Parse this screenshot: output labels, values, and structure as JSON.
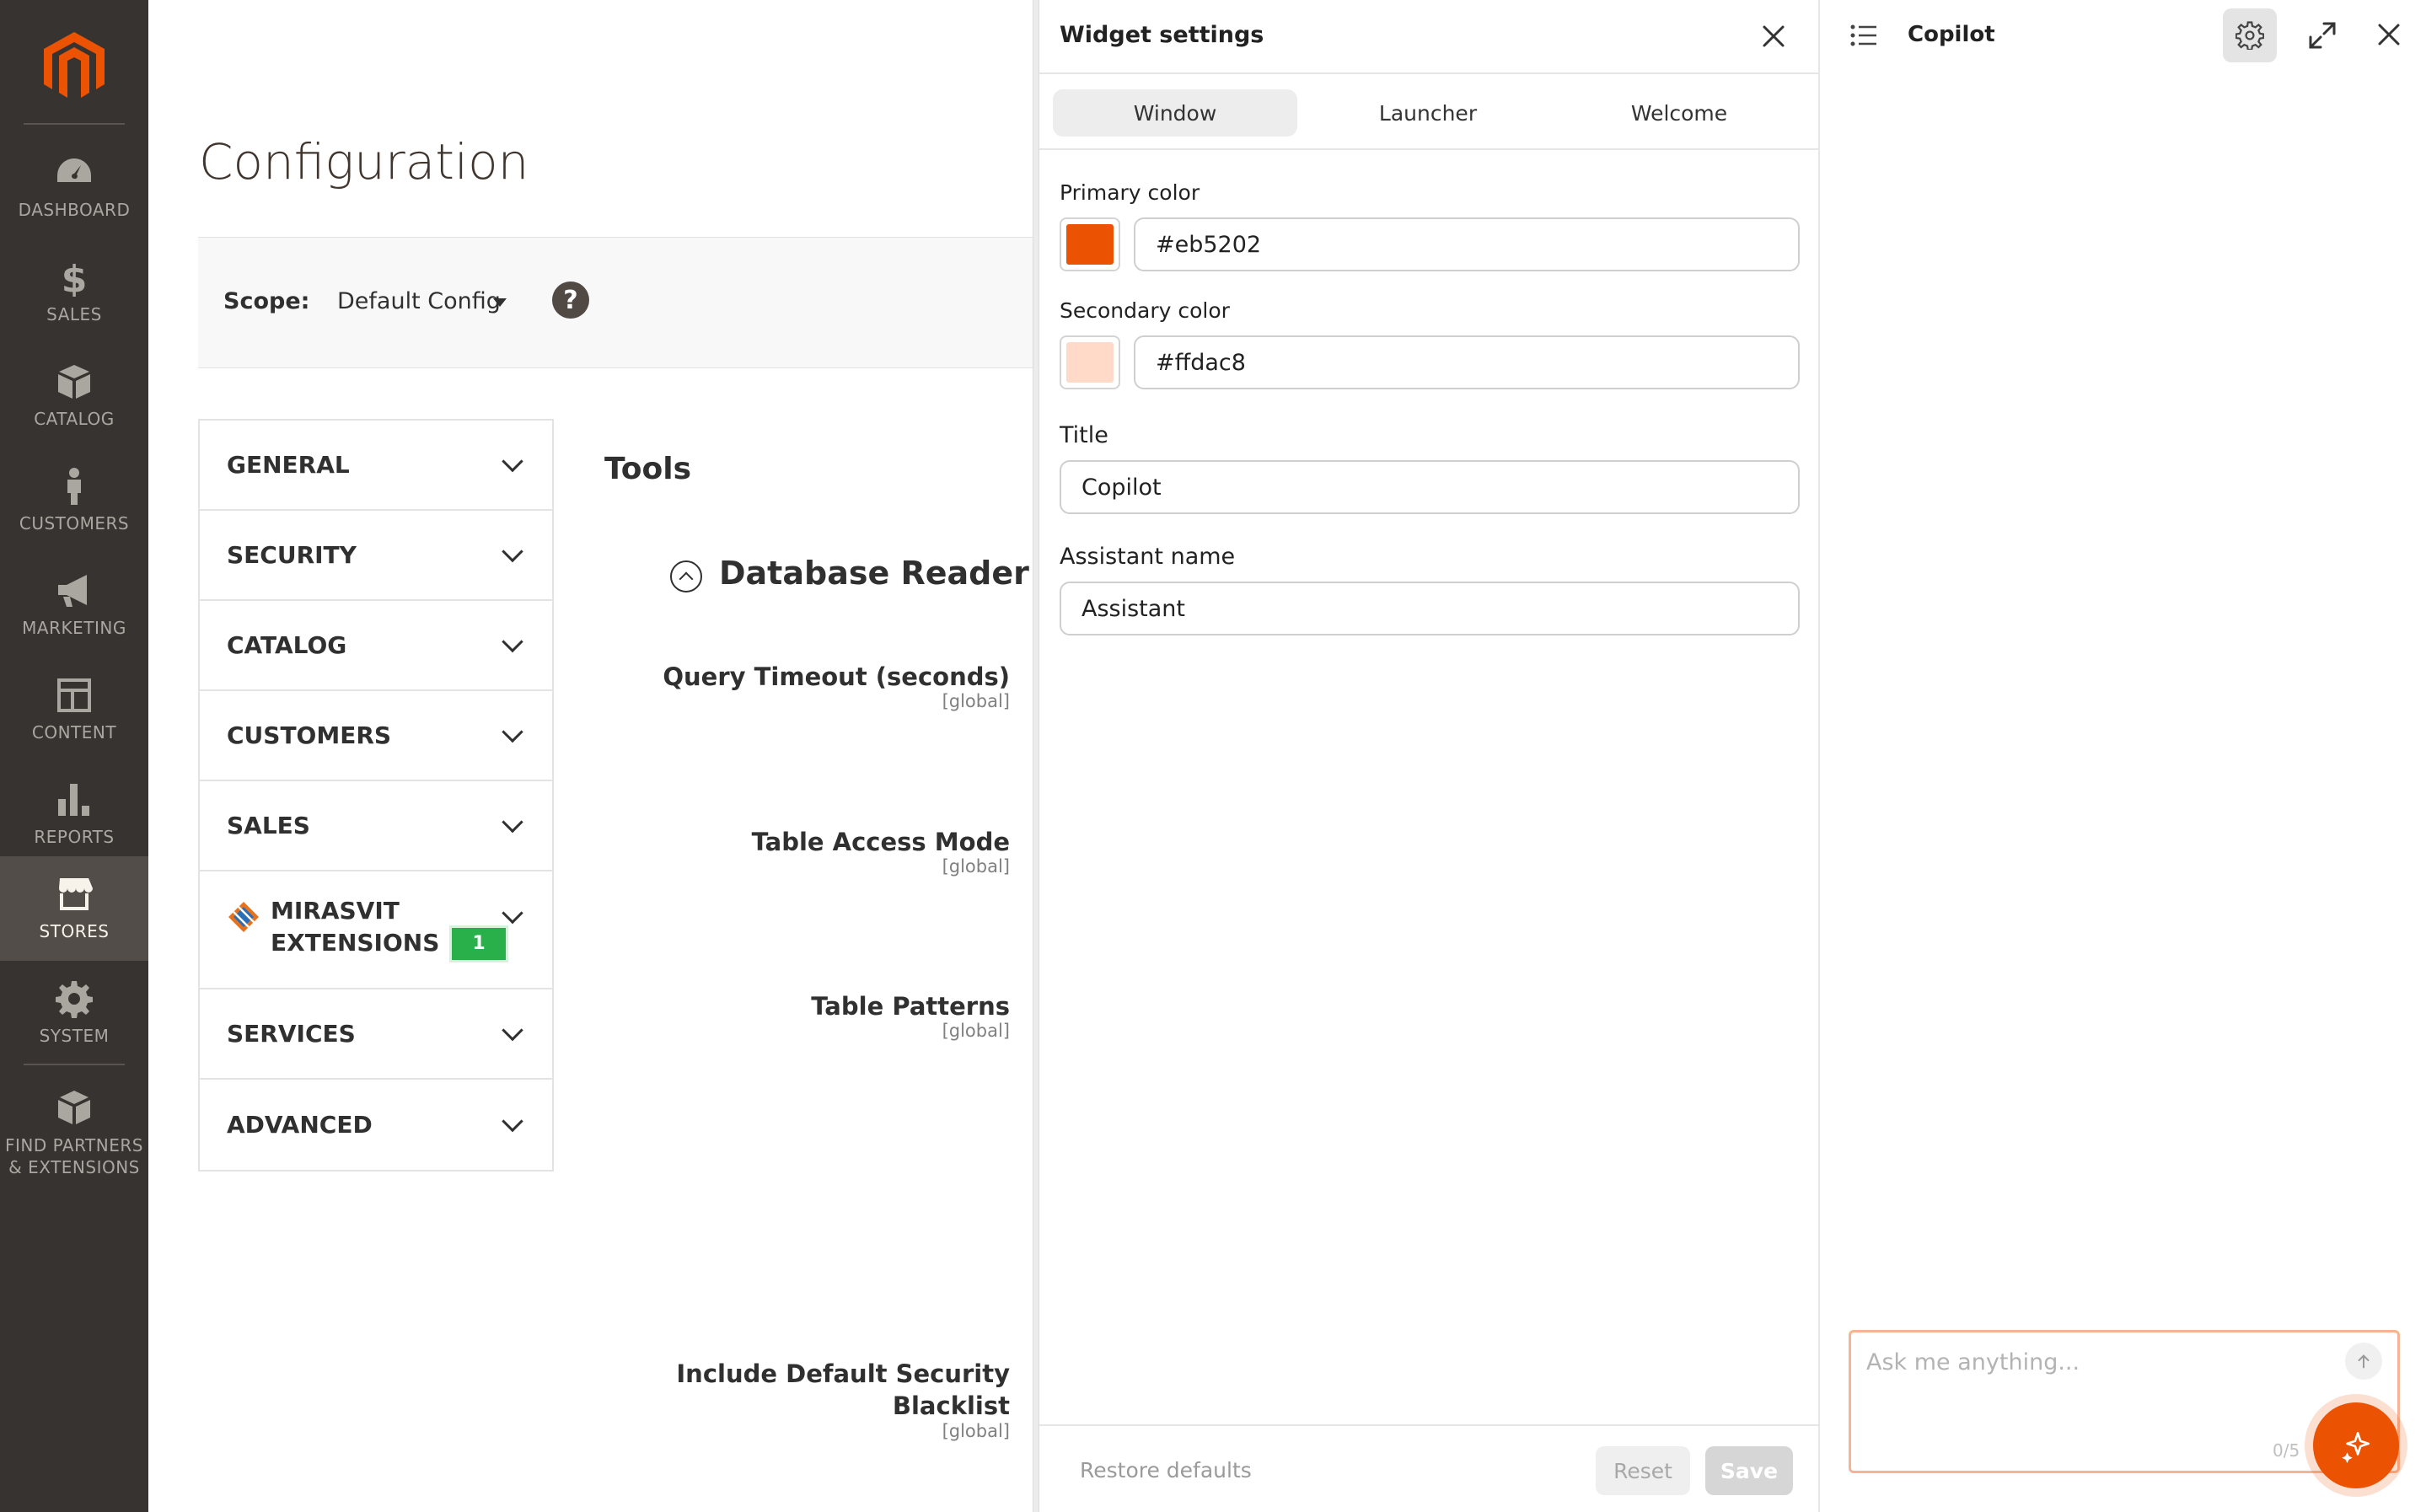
{
  "colors": {
    "sidebar_bg": "#373330",
    "sidebar_active": "#524d49",
    "primary": "#eb5202",
    "secondary": "#ffdac8",
    "badge": "#2ab04a"
  },
  "sidebar": {
    "items": [
      {
        "label": "DASHBOARD",
        "icon": "dashboard-icon"
      },
      {
        "label": "SALES",
        "icon": "dollar-icon"
      },
      {
        "label": "CATALOG",
        "icon": "box-icon"
      },
      {
        "label": "CUSTOMERS",
        "icon": "person-icon"
      },
      {
        "label": "MARKETING",
        "icon": "megaphone-icon"
      },
      {
        "label": "CONTENT",
        "icon": "layout-icon"
      },
      {
        "label": "REPORTS",
        "icon": "bar-chart-icon"
      },
      {
        "label": "STORES",
        "icon": "storefront-icon"
      },
      {
        "label": "SYSTEM",
        "icon": "gear-icon"
      },
      {
        "label": "FIND PARTNERS & EXTENSIONS",
        "icon": "cubes-icon"
      }
    ],
    "active": "STORES"
  },
  "main": {
    "title": "Configuration",
    "scope_label": "Scope:",
    "scope_value": "Default Config",
    "help": "?",
    "nav": [
      {
        "label": "GENERAL"
      },
      {
        "label": "SECURITY"
      },
      {
        "label": "CATALOG"
      },
      {
        "label": "CUSTOMERS"
      },
      {
        "label": "SALES"
      },
      {
        "label_line1": "MIRASVIT",
        "label_line2": "EXTENSIONS",
        "badge": "1"
      },
      {
        "label": "SERVICES"
      },
      {
        "label": "ADVANCED"
      }
    ],
    "tools_title": "Tools",
    "section_title": "Database Reader",
    "fields": [
      {
        "label": "Query Timeout (seconds)",
        "scope": "[global]"
      },
      {
        "label": "Table Access Mode",
        "scope": "[global]"
      },
      {
        "label": "Table Patterns",
        "scope": "[global]"
      },
      {
        "label_line1": "Include Default Security",
        "label_line2": "Blacklist",
        "scope": "[global]"
      }
    ]
  },
  "widget": {
    "title": "Widget settings",
    "tabs": [
      {
        "label": "Window",
        "active": true
      },
      {
        "label": "Launcher",
        "active": false
      },
      {
        "label": "Welcome",
        "active": false
      }
    ],
    "primary_label": "Primary color",
    "primary_value": "#eb5202",
    "secondary_label": "Secondary color",
    "secondary_value": "#ffdac8",
    "title_label": "Title",
    "title_value": "Copilot",
    "assistant_label": "Assistant name",
    "assistant_value": "Assistant",
    "restore": "Restore defaults",
    "reset": "Reset",
    "save": "Save"
  },
  "copilot": {
    "title": "Copilot",
    "placeholder": "Ask me anything...",
    "counter": "0/5"
  }
}
